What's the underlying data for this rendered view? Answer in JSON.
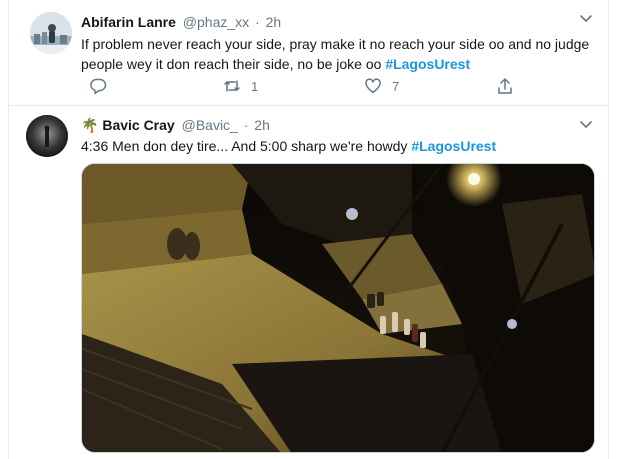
{
  "tweets": [
    {
      "name": "Abifarin Lanre",
      "handle": "@phaz_xx",
      "separator": "·",
      "time": "2h",
      "text": "If problem never reach your side, pray make it no reach your side oo and no judge people wey it don reach their side, no be joke oo",
      "hashtag": "#LagosUrest",
      "retweet_count": "1",
      "like_count": "7",
      "avatar_icon": "avatar-photo-icon"
    },
    {
      "name": "Bavic Cray",
      "name_emoji": "🌴",
      "handle": "@Bavic_",
      "separator": "·",
      "time": "2h",
      "text": "4:36 Men don dey tire... And 5:00 sharp we're howdy",
      "hashtag": "#LagosUrest",
      "media_icon": "night-street-photo"
    }
  ],
  "colors": {
    "hashtag": "#1b95e0",
    "secondary_text": "#657786",
    "border": "#e6ecf0"
  }
}
